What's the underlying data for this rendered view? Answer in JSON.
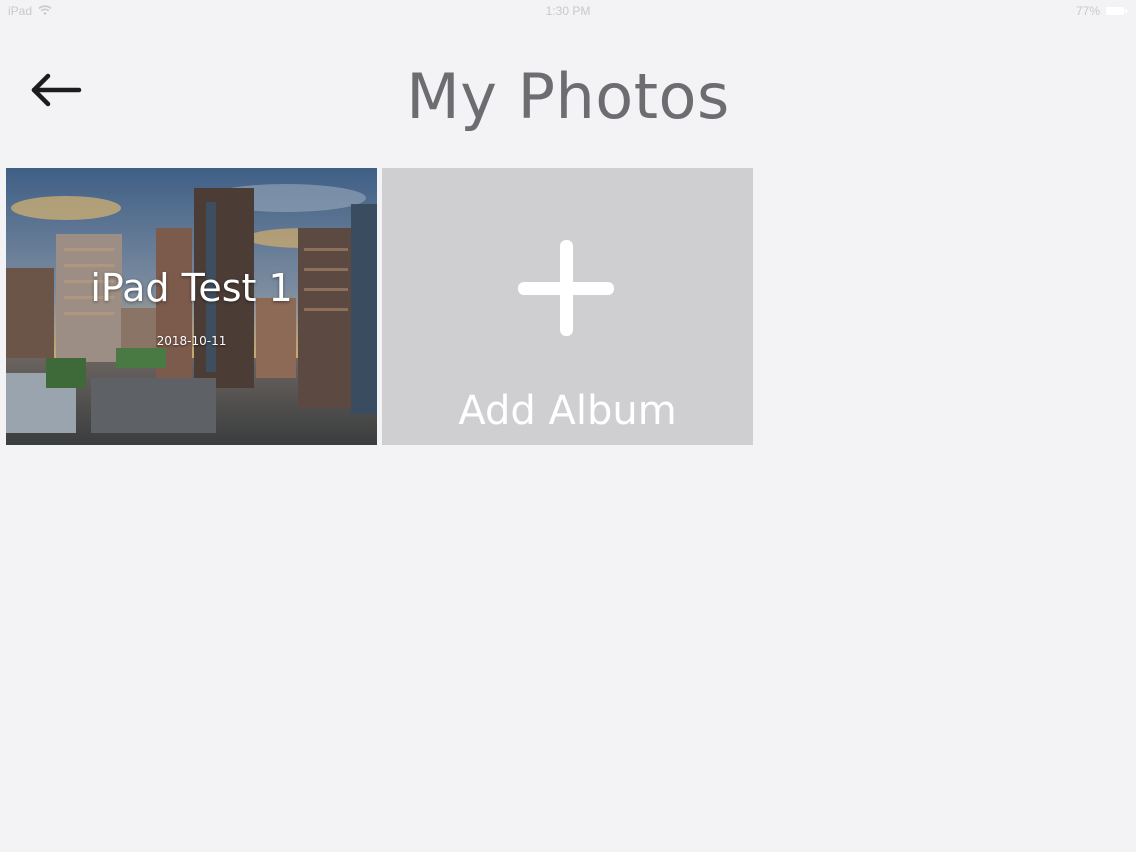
{
  "status_bar": {
    "carrier": "iPad",
    "time": "1:30 PM",
    "battery_percent": "77%",
    "icons": [
      "wifi-icon",
      "battery-icon"
    ]
  },
  "header": {
    "title": "My Photos",
    "back_icon": "arrow-left-icon"
  },
  "albums": [
    {
      "title": "iPad Test 1",
      "date": "2018-10-11",
      "thumbnail": "city-skyline-photo"
    }
  ],
  "add_album": {
    "label": "Add Album",
    "icon": "plus-icon"
  },
  "colors": {
    "background": "#f3f2f5",
    "title_text": "#6d6c70",
    "add_tile": "#cfced1"
  }
}
